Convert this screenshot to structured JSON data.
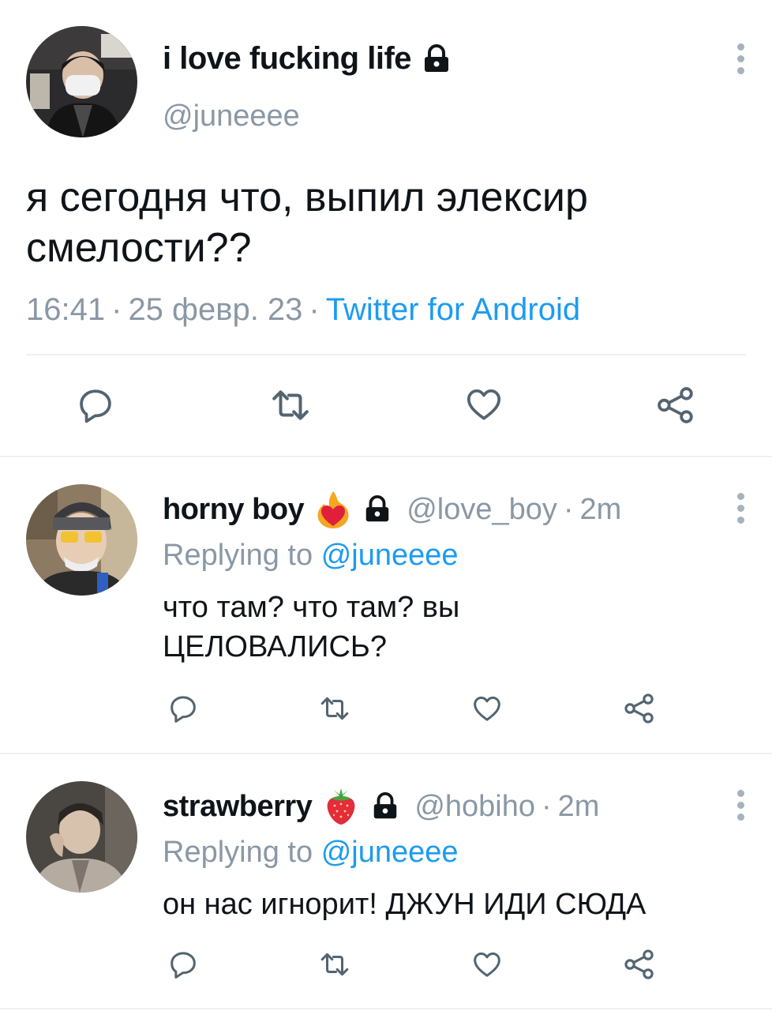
{
  "main_tweet": {
    "display_name": "i love fucking life",
    "handle": "@juneeee",
    "text_line1": "я сегодня что, выпил элексир",
    "text_line2": "смелости??",
    "time": "16:41",
    "date": "25 февр. 23",
    "source": "Twitter for Android",
    "separator": "·"
  },
  "replies": [
    {
      "display_name": "horny boy",
      "handle": "@love_boy",
      "age": "2m",
      "replying_prefix": "Replying to",
      "replying_handle": "@juneeee",
      "text_line1": "что там? что там? вы",
      "text_line2": "ЦЕЛОВАЛИСЬ?",
      "emoji": "heart-on-fire-icon"
    },
    {
      "display_name": "strawberry",
      "handle": "@hobiho",
      "age": "2m",
      "replying_prefix": "Replying to",
      "replying_handle": "@juneeee",
      "text_line1": "он нас игнорит! ДЖУН ИДИ СЮДА",
      "emoji": "strawberry-icon"
    }
  ],
  "colors": {
    "text": "#0f1419",
    "secondary": "#8a98a5",
    "link": "#1d9bf0",
    "icon": "#536471",
    "divider": "#eef1f3"
  }
}
